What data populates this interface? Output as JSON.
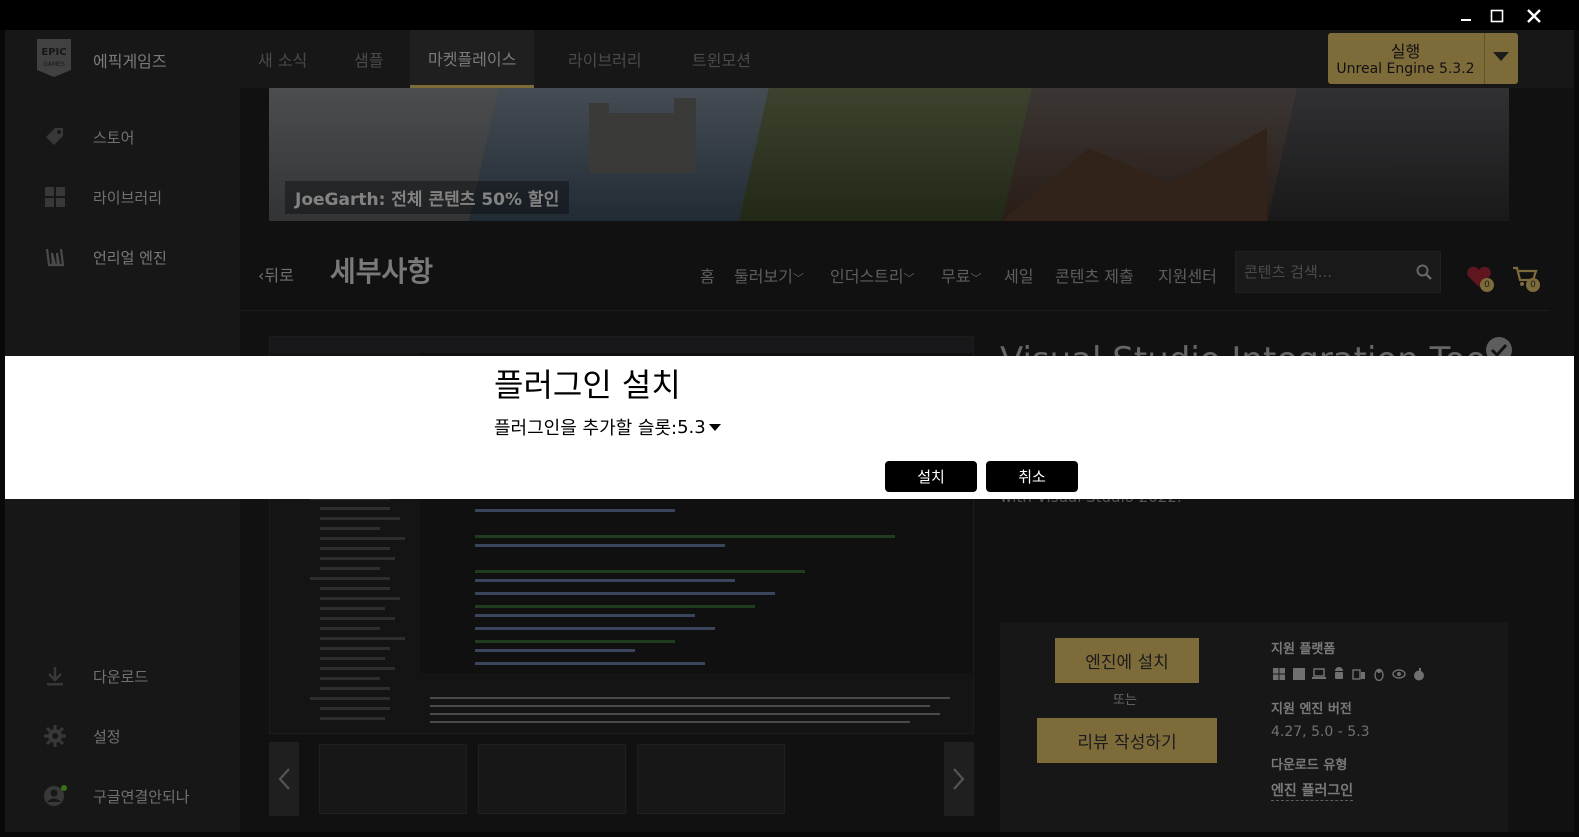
{
  "app": {
    "brand": "에픽게임즈"
  },
  "sidebar": {
    "items": [
      {
        "label": "스토어",
        "icon": "tag-icon"
      },
      {
        "label": "라이브러리",
        "icon": "grid-icon"
      },
      {
        "label": "언리얼 엔진",
        "icon": "unreal-icon"
      },
      {
        "label": "다운로드",
        "icon": "download-icon"
      },
      {
        "label": "설정",
        "icon": "gear-icon"
      },
      {
        "label": "구글연결안되나",
        "icon": "user-icon"
      }
    ]
  },
  "topnav": {
    "tabs": [
      {
        "label": "새 소식"
      },
      {
        "label": "샘플"
      },
      {
        "label": "마켓플레이스",
        "active": true
      },
      {
        "label": "라이브러리"
      },
      {
        "label": "트윈모션"
      }
    ],
    "launch": {
      "label": "실행",
      "version": "Unreal Engine 5.3.2"
    }
  },
  "banner": {
    "text": "JoeGarth: 전체 콘텐츠 50% 할인"
  },
  "subnav": {
    "back": "‹뒤로",
    "title": "세부사항",
    "items": [
      "홈",
      "둘러보기",
      "인더스트리",
      "무료",
      "세일",
      "콘텐츠 제출",
      "지원센터"
    ],
    "search_placeholder": "콘텐츠 검색...",
    "wishlist_count": "0",
    "cart_count": "0"
  },
  "product": {
    "title": "Visual Studio Integration Tool",
    "desc": "with Visual Studio 2022."
  },
  "info": {
    "install_button": "엔진에 설치",
    "or": "또는",
    "review_button": "리뷰 작성하기",
    "platforms_label": "지원 플랫폼",
    "engine_label": "지원 엔진 버전",
    "engine_value": "4.27, 5.0 - 5.3",
    "download_label": "다운로드 유형",
    "download_value": "엔진 플러그인"
  },
  "dialog": {
    "title": "플러그인 설치",
    "slot_label": "플러그인을 추가할 슬롯:",
    "slot_value": "5.3",
    "install": "설치",
    "cancel": "취소"
  },
  "colors": {
    "accent": "#e4c36b",
    "sidebar_bg": "#2a2a2a",
    "main_bg": "#202020"
  }
}
